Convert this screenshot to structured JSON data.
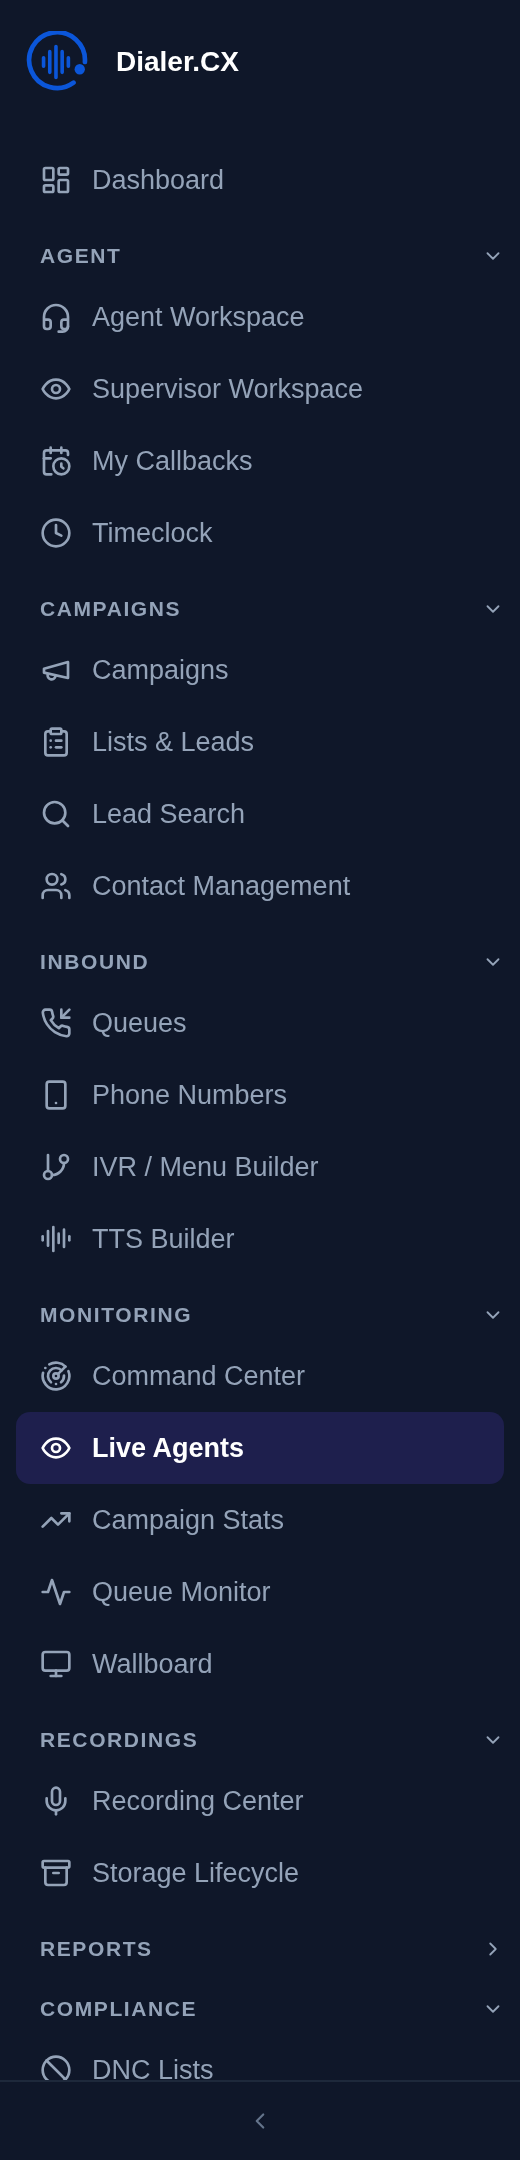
{
  "brand": {
    "name": "Dialer.CX"
  },
  "nav": [
    {
      "kind": "link",
      "label": "Dashboard",
      "selected": false
    },
    {
      "kind": "section",
      "title": "AGENT",
      "expanded": true,
      "items": [
        {
          "label": "Agent Workspace",
          "selected": false
        },
        {
          "label": "Supervisor Workspace",
          "selected": false
        },
        {
          "label": "My Callbacks",
          "selected": false
        },
        {
          "label": "Timeclock",
          "selected": false
        }
      ]
    },
    {
      "kind": "section",
      "title": "CAMPAIGNS",
      "expanded": true,
      "items": [
        {
          "label": "Campaigns",
          "selected": false
        },
        {
          "label": "Lists & Leads",
          "selected": false
        },
        {
          "label": "Lead Search",
          "selected": false
        },
        {
          "label": "Contact Management",
          "selected": false
        }
      ]
    },
    {
      "kind": "section",
      "title": "INBOUND",
      "expanded": true,
      "items": [
        {
          "label": "Queues",
          "selected": false
        },
        {
          "label": "Phone Numbers",
          "selected": false
        },
        {
          "label": "IVR / Menu Builder",
          "selected": false
        },
        {
          "label": "TTS Builder",
          "selected": false
        }
      ]
    },
    {
      "kind": "section",
      "title": "MONITORING",
      "expanded": true,
      "items": [
        {
          "label": "Command Center",
          "selected": false
        },
        {
          "label": "Live Agents",
          "selected": true
        },
        {
          "label": "Campaign Stats",
          "selected": false
        },
        {
          "label": "Queue Monitor",
          "selected": false
        },
        {
          "label": "Wallboard",
          "selected": false
        }
      ]
    },
    {
      "kind": "section",
      "title": "RECORDINGS",
      "expanded": true,
      "items": [
        {
          "label": "Recording Center",
          "selected": false
        },
        {
          "label": "Storage Lifecycle",
          "selected": false
        }
      ]
    },
    {
      "kind": "section",
      "title": "REPORTS",
      "expanded": false
    },
    {
      "kind": "section",
      "title": "COMPLIANCE",
      "expanded": true,
      "items": [
        {
          "label": "DNC Lists",
          "selected": false
        }
      ]
    }
  ]
}
